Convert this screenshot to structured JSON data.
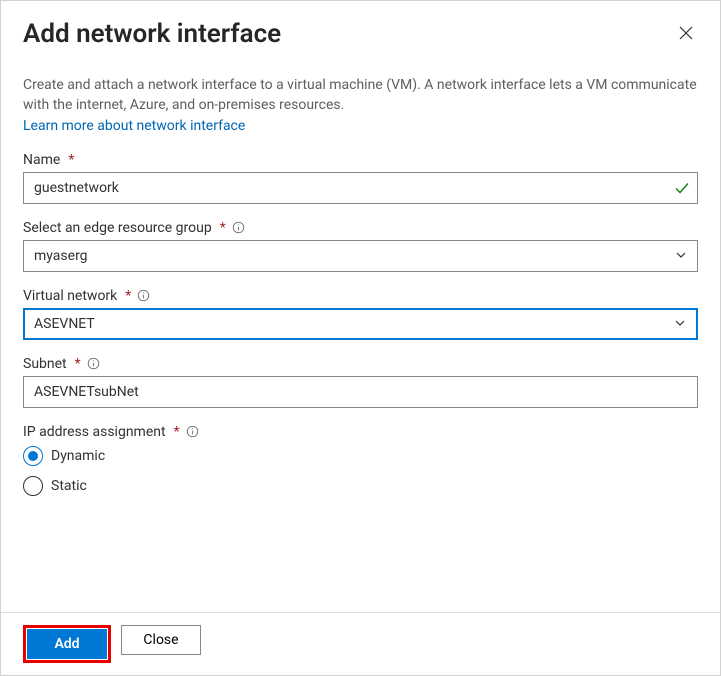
{
  "header": {
    "title": "Add network interface"
  },
  "intro": {
    "description": "Create and attach a network interface to a virtual machine (VM). A network interface lets a VM communicate with the internet, Azure, and on-premises resources.",
    "link_label": "Learn more about network interface"
  },
  "fields": {
    "name": {
      "label": "Name",
      "value": "guestnetwork"
    },
    "resource_group": {
      "label": "Select an edge resource group",
      "value": "myaserg"
    },
    "vnet": {
      "label": "Virtual network",
      "value": "ASEVNET"
    },
    "subnet": {
      "label": "Subnet",
      "value": "ASEVNETsubNet"
    },
    "ip_assignment": {
      "label": "IP address assignment",
      "options": {
        "dynamic": "Dynamic",
        "static": "Static"
      },
      "selected": "dynamic"
    }
  },
  "footer": {
    "add_label": "Add",
    "close_label": "Close"
  }
}
